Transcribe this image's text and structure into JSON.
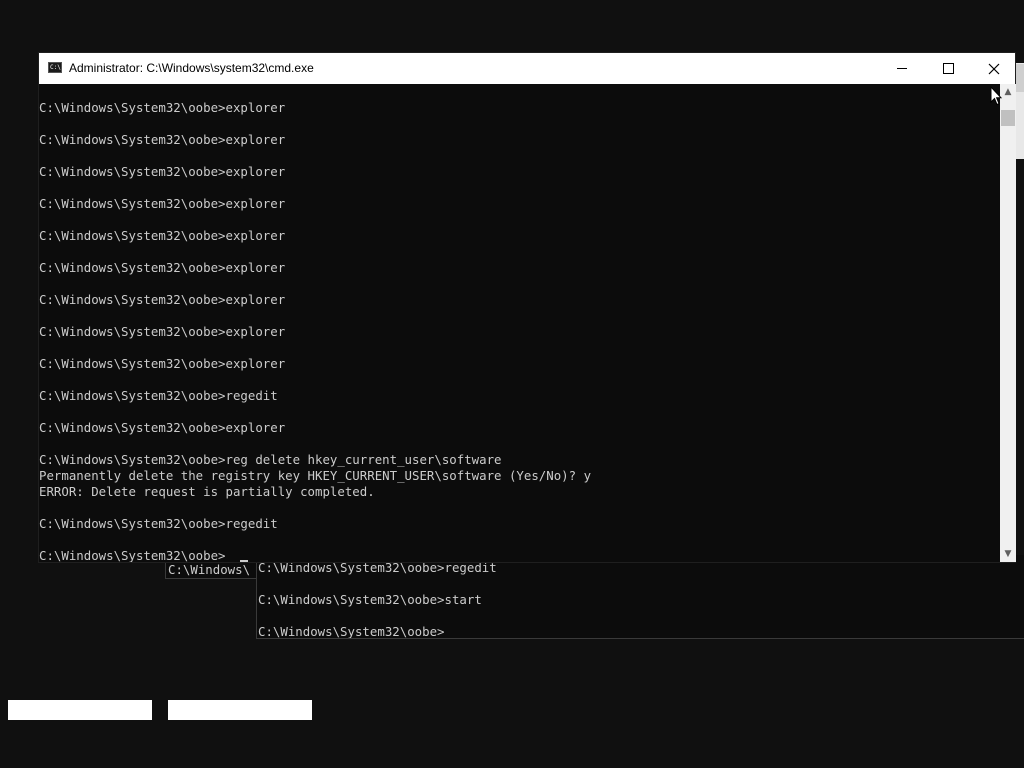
{
  "window": {
    "title": "Administrator: C:\\Windows\\system32\\cmd.exe",
    "icon_text": "C:\\."
  },
  "console_lines": [
    "C:\\Windows\\System32\\oobe>explorer",
    "",
    "C:\\Windows\\System32\\oobe>explorer",
    "",
    "C:\\Windows\\System32\\oobe>explorer",
    "",
    "C:\\Windows\\System32\\oobe>explorer",
    "",
    "C:\\Windows\\System32\\oobe>explorer",
    "",
    "C:\\Windows\\System32\\oobe>explorer",
    "",
    "C:\\Windows\\System32\\oobe>explorer",
    "",
    "C:\\Windows\\System32\\oobe>explorer",
    "",
    "C:\\Windows\\System32\\oobe>explorer",
    "",
    "C:\\Windows\\System32\\oobe>regedit",
    "",
    "C:\\Windows\\System32\\oobe>explorer",
    "",
    "C:\\Windows\\System32\\oobe>reg delete hkey_current_user\\software",
    "Permanently delete the registry key HKEY_CURRENT_USER\\software (Yes/No)? y",
    "ERROR: Delete request is partially completed.",
    "",
    "C:\\Windows\\System32\\oobe>regedit",
    "",
    "C:\\Windows\\System32\\oobe>"
  ],
  "background_console_left": {
    "text": "C:\\Windows\\"
  },
  "background_console_right": {
    "lines": [
      "C:\\Windows\\System32\\oobe>regedit",
      "",
      "C:\\Windows\\System32\\oobe>start",
      "",
      "C:\\Windows\\System32\\oobe>"
    ]
  },
  "colors": {
    "console_bg": "#0c0c0c",
    "console_text": "#cccccc",
    "desktop_bg": "#101010",
    "titlebar_bg": "#ffffff"
  },
  "icons": {
    "minimize": "minimize-icon",
    "maximize": "maximize-icon",
    "close": "close-icon",
    "scroll_up": "chevron-up-icon",
    "scroll_down": "chevron-down-icon",
    "pointer": "mouse-pointer-icon"
  }
}
